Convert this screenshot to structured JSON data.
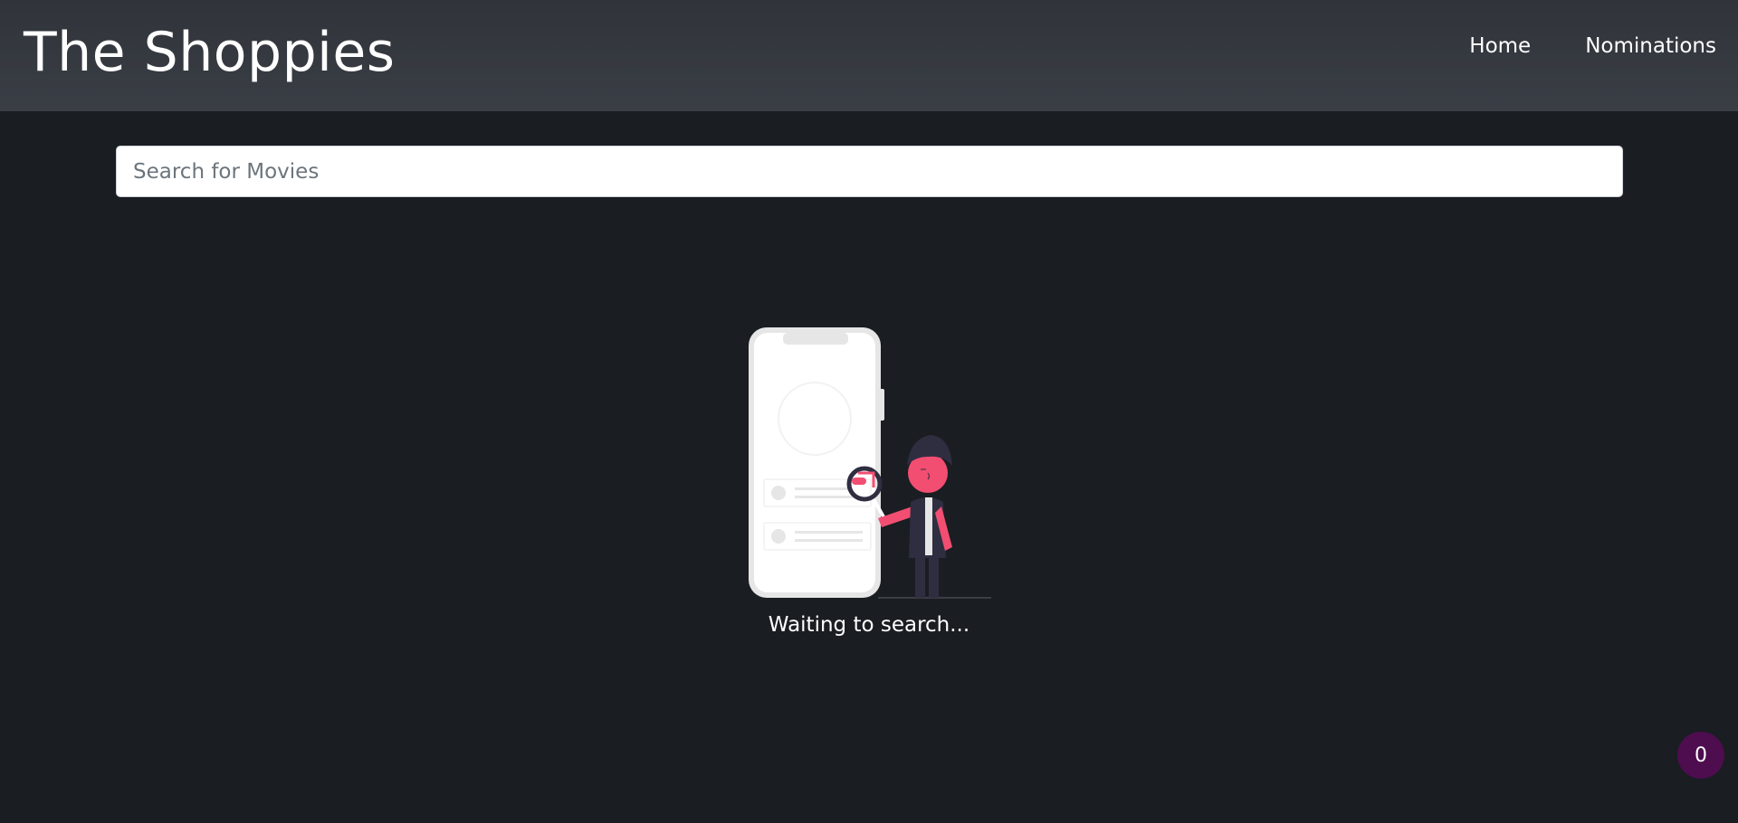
{
  "navbar": {
    "brand": "The Shoppies",
    "links": [
      {
        "label": "Home"
      },
      {
        "label": "Nominations"
      }
    ]
  },
  "search": {
    "value": "",
    "placeholder": "Search for Movies"
  },
  "empty_state": {
    "illustration": "phone-search-illustration",
    "message": "Waiting to search..."
  },
  "nominations_badge": {
    "count": "0"
  },
  "colors": {
    "background": "#1a1d22",
    "navbar": "#353940",
    "accent": "#f24e72",
    "badge": "#4e0d4f"
  }
}
